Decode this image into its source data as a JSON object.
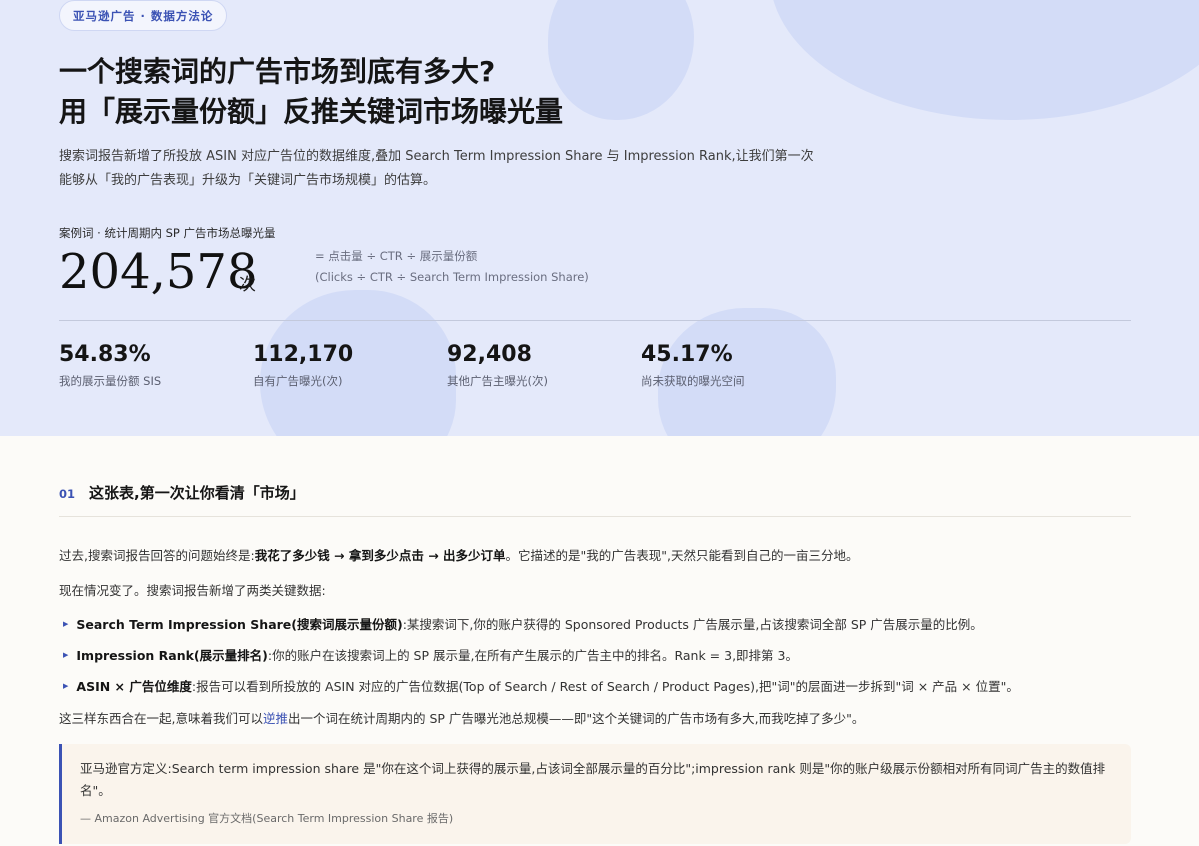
{
  "hero": {
    "tag": "亚马逊广告 · 数据方法论",
    "title_line1": "一个搜索词的广告市场到底有多大?",
    "title_line2": "用「展示量份额」反推关键词市场曝光量",
    "lead_line1": "搜索词报告新增了所投放 ASIN 对应广告位的数据维度,叠加 Search Term Impression Share 与 Impression Rank,让我们第一次",
    "lead_line2": "能够从「我的广告表现」升级为「关键词广告市场规模」的估算。",
    "metric_label": "案例词 · 统计周期内 SP 广告市场总曝光量",
    "metric_value": "204,578",
    "metric_unit": "次",
    "formula_cn": "= 点击量 ÷ CTR ÷ 展示量份额",
    "formula_en": "(Clicks ÷ CTR ÷ Search Term Impression Share)",
    "stats": [
      {
        "value": "54.83%",
        "label": "我的展示量份额 SIS"
      },
      {
        "value": "112,170",
        "label": "自有广告曝光(次)"
      },
      {
        "value": "92,408",
        "label": "其他广告主曝光(次)"
      },
      {
        "value": "45.17%",
        "label": "尚未获取的曝光空间"
      }
    ]
  },
  "section": {
    "number": "01",
    "title": "这张表,第一次让你看清「市场」",
    "p1_a": "过去,搜索词报告回答的问题始终是:",
    "p1_b": "我花了多少钱 → 拿到多少点击 → 出多少订单",
    "p1_c": "。它描述的是\"我的广告表现\",天然只能看到自己的一亩三分地。",
    "p2": "现在情况变了。搜索词报告新增了两类关键数据:",
    "bullets": [
      {
        "bold": "Search Term Impression Share(搜索词展示量份额)",
        "text": ":某搜索词下,你的账户获得的 Sponsored Products 广告展示量,占该搜索词全部 SP 广告展示量的比例。"
      },
      {
        "bold": "Impression Rank(展示量排名)",
        "text": ":你的账户在该搜索词上的 SP 展示量,在所有产生展示的广告主中的排名。Rank = 3,即排第 3。"
      },
      {
        "bold": "ASIN × 广告位维度",
        "text": ":报告可以看到所投放的 ASIN 对应的广告位数据(Top of Search / Rest of Search / Product Pages),把\"词\"的层面进一步拆到\"词 × 产品 × 位置\"。"
      }
    ],
    "p3_a": "这三样东西合在一起,意味着我们可以",
    "p3_link": "逆推",
    "p3_b": "出一个词在统计周期内的 SP 广告曝光池总规模——即\"这个关键词的广告市场有多大,而我吃掉了多少\"。",
    "quote_text": "亚马逊官方定义:Search term impression share 是\"你在这个词上获得的展示量,占该词全部展示量的百分比\";impression rank 则是\"你的账户级展示份额相对所有同词广告主的数值排名\"。",
    "quote_source": "— Amazon Advertising 官方文档(Search Term Impression Share 报告)"
  }
}
